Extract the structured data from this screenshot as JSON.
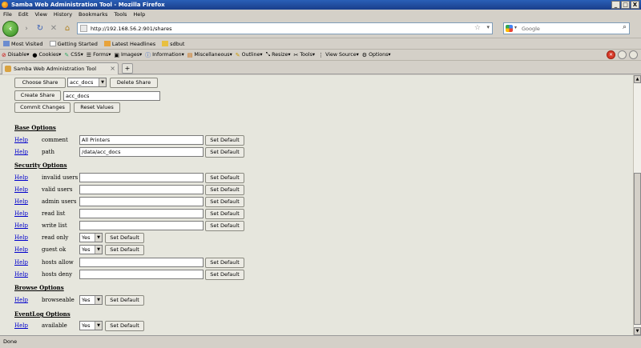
{
  "window": {
    "title": "Samba Web Administration Tool - Mozilla Firefox",
    "min": "_",
    "max": "□",
    "close": "X"
  },
  "menu": [
    "File",
    "Edit",
    "View",
    "History",
    "Bookmarks",
    "Tools",
    "Help"
  ],
  "url": "http://192.168.56.2:901/shares",
  "search_placeholder": "Google",
  "bookmarks": [
    "Most Visited",
    "Getting Started",
    "Latest Headlines",
    "sdbut"
  ],
  "devtoolbar": [
    "Disable▾",
    "Cookies▾",
    "CSS▾",
    "Forms▾",
    "Images▾",
    "Information▾",
    "Miscellaneous▾",
    "Outline▾",
    "Resize▾",
    "Tools▾",
    "View Source▾",
    "Options▾"
  ],
  "tab": {
    "label": "Samba Web Administration Tool",
    "new": "+"
  },
  "top": {
    "choose_share": "Choose Share",
    "share_value": "acc_docs",
    "delete_share": "Delete Share",
    "create_share": "Create Share",
    "create_value": "acc_docs",
    "commit": "Commit Changes",
    "reset": "Reset Values"
  },
  "help_label": "Help",
  "set_default": "Set Default",
  "sections": {
    "base": "Base Options",
    "security": "Security Options",
    "browse": "Browse Options",
    "eventlog": "EventLog Options"
  },
  "base": [
    {
      "label": "comment",
      "value": "All Printers"
    },
    {
      "label": "path",
      "value": "/data/acc_docs"
    }
  ],
  "security_text": [
    {
      "label": "invalid users",
      "value": ""
    },
    {
      "label": "valid users",
      "value": ""
    },
    {
      "label": "admin users",
      "value": ""
    },
    {
      "label": "read list",
      "value": ""
    },
    {
      "label": "write list",
      "value": ""
    }
  ],
  "security_select": [
    {
      "label": "read only",
      "value": "Yes"
    },
    {
      "label": "guest ok",
      "value": "Yes"
    }
  ],
  "security_hosts": [
    {
      "label": "hosts allow",
      "value": ""
    },
    {
      "label": "hosts deny",
      "value": ""
    }
  ],
  "browse": {
    "label": "browseable",
    "value": "Yes"
  },
  "eventlog": {
    "label": "available",
    "value": "Yes"
  },
  "status": "Done"
}
